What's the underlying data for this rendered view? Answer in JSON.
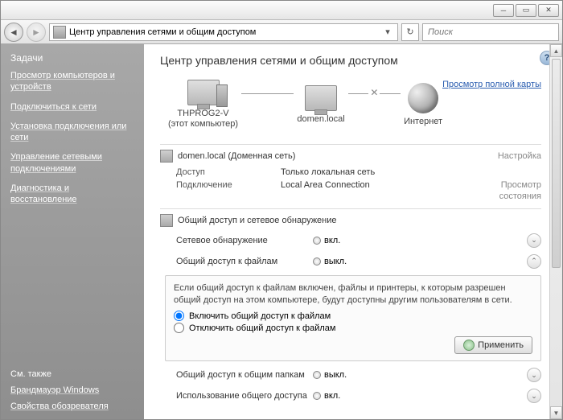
{
  "address_bar": {
    "path": "Центр управления сетями и общим доступом"
  },
  "search": {
    "placeholder": "Поиск"
  },
  "page": {
    "title": "Центр управления сетями и общим доступом",
    "map_link": "Просмотр полной карты"
  },
  "sidebar": {
    "tasks_heading": "Задачи",
    "tasks": [
      "Просмотр компьютеров и устройств",
      "Подключиться к сети",
      "Установка подключения или сети",
      "Управление сетевыми подключениями",
      "Диагностика и восстановление"
    ],
    "see_also": "См. также",
    "footer": [
      "Брандмауэр Windows",
      "Свойства обозревателя"
    ]
  },
  "netmap": {
    "node1": {
      "name": "THPROG2-V",
      "sub": "(этот компьютер)"
    },
    "node2": {
      "name": "domen.local"
    },
    "node3": {
      "name": "Интернет"
    }
  },
  "network": {
    "title": "domen.local (Доменная сеть)",
    "settings_link": "Настройка",
    "access_label": "Доступ",
    "access_value": "Только локальная сеть",
    "conn_label": "Подключение",
    "conn_value": "Local Area Connection",
    "state_link": "Просмотр состояния"
  },
  "sharing": {
    "heading": "Общий доступ и сетевое обнаружение",
    "rows": {
      "discovery": {
        "label": "Сетевое обнаружение",
        "status": "вкл."
      },
      "fileshare": {
        "label": "Общий доступ к файлам",
        "status": "выкл."
      },
      "publicshare": {
        "label": "Общий доступ к общим папкам",
        "status": "выкл."
      },
      "printershare": {
        "label": "Использование общего доступа",
        "status": "вкл."
      }
    },
    "panel": {
      "hint": "Если общий доступ к файлам включен, файлы и принтеры, к которым разрешен общий доступ на этом компьютере, будут доступны другим пользователям в сети.",
      "opt_on": "Включить общий доступ к файлам",
      "opt_off": "Отключить общий доступ к файлам",
      "apply": "Применить"
    }
  }
}
